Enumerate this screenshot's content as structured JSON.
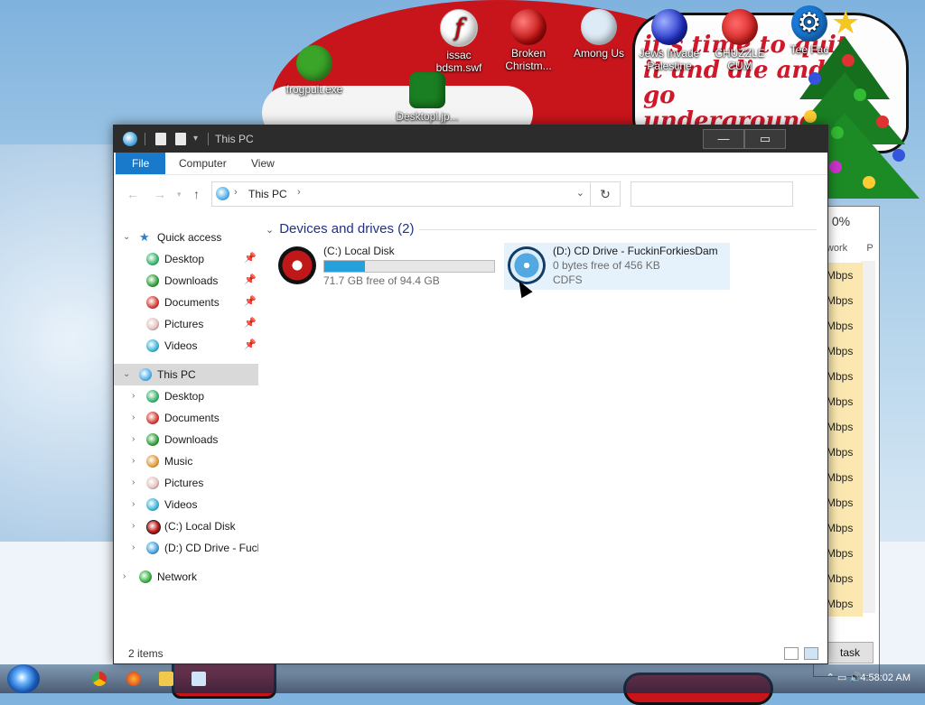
{
  "wallpaper": {
    "sign_text": "it's time to quit it and die and go underground"
  },
  "desktop_icons": [
    {
      "label": "frogpult.exe",
      "icon": "frog-icon"
    },
    {
      "label": "issac bdsm.swf",
      "icon": "flash-swf-icon"
    },
    {
      "label": "Broken Christm...",
      "icon": "ornament-icon"
    },
    {
      "label": "Among Us",
      "icon": "among-us-icon"
    },
    {
      "label": "Jews Invade Palestine",
      "icon": "blue-ornament-icon"
    },
    {
      "label": "CHUZZLE CUM",
      "icon": "chuzzle-icon"
    },
    {
      "label": "Tee Fac",
      "icon": "gear-icon"
    },
    {
      "label": "Desktopl.jp...",
      "icon": "christmas-tree-icon"
    }
  ],
  "background_window": {
    "header_value": "0%",
    "header_label": "twork",
    "header_col2": "P",
    "cells": [
      "Mbps",
      "Mbps",
      "Mbps",
      "Mbps",
      "Mbps",
      "Mbps",
      "Mbps",
      "Mbps",
      "Mbps",
      "Mbps",
      "Mbps",
      "Mbps",
      "Mbps",
      "Mbps"
    ],
    "button_label": "task"
  },
  "window": {
    "title": "This PC",
    "ribbon_tabs": [
      "File",
      "Computer",
      "View"
    ],
    "address": {
      "crumb": "This PC"
    },
    "search_placeholder": ""
  },
  "nav": {
    "quick_access": {
      "label": "Quick access",
      "items": [
        {
          "label": "Desktop",
          "icon": "desktop-icon",
          "pinned": true
        },
        {
          "label": "Downloads",
          "icon": "downloads-icon",
          "pinned": true
        },
        {
          "label": "Documents",
          "icon": "documents-icon",
          "pinned": true
        },
        {
          "label": "Pictures",
          "icon": "pictures-icon",
          "pinned": true
        },
        {
          "label": "Videos",
          "icon": "videos-icon",
          "pinned": true
        }
      ]
    },
    "this_pc": {
      "label": "This PC",
      "items": [
        {
          "label": "Desktop",
          "icon": "desktop-icon"
        },
        {
          "label": "Documents",
          "icon": "documents-icon"
        },
        {
          "label": "Downloads",
          "icon": "downloads-icon"
        },
        {
          "label": "Music",
          "icon": "music-icon"
        },
        {
          "label": "Pictures",
          "icon": "pictures-icon"
        },
        {
          "label": "Videos",
          "icon": "videos-icon"
        },
        {
          "label": "(C:) Local Disk",
          "icon": "local-disk-icon"
        },
        {
          "label": "(D:) CD Drive - Fuck",
          "icon": "cd-drive-icon"
        }
      ]
    },
    "network": {
      "label": "Network"
    }
  },
  "content": {
    "group_title": "Devices and drives (2)",
    "drives": [
      {
        "name": "(C:) Local Disk",
        "info": "71.7 GB free of 94.4 GB",
        "used_fraction": 0.24,
        "icon": "local-disk-icon"
      },
      {
        "name": "(D:) CD Drive - FuckinForkiesDam",
        "info": "0 bytes free of 456 KB",
        "fs": "CDFS",
        "icon": "cd-drive-icon"
      }
    ]
  },
  "status": {
    "count": "2 items"
  },
  "taskbar": {
    "clock": "4:58:02 AM",
    "pinned": [
      "chrome-icon",
      "firefox-icon",
      "file-explorer-icon",
      "task-manager-icon"
    ]
  },
  "colors": {
    "accent": "#1979ca",
    "titlebar": "#2c2c2c",
    "selected_drive": "#e5f1fb",
    "progress": "#26a0da"
  }
}
